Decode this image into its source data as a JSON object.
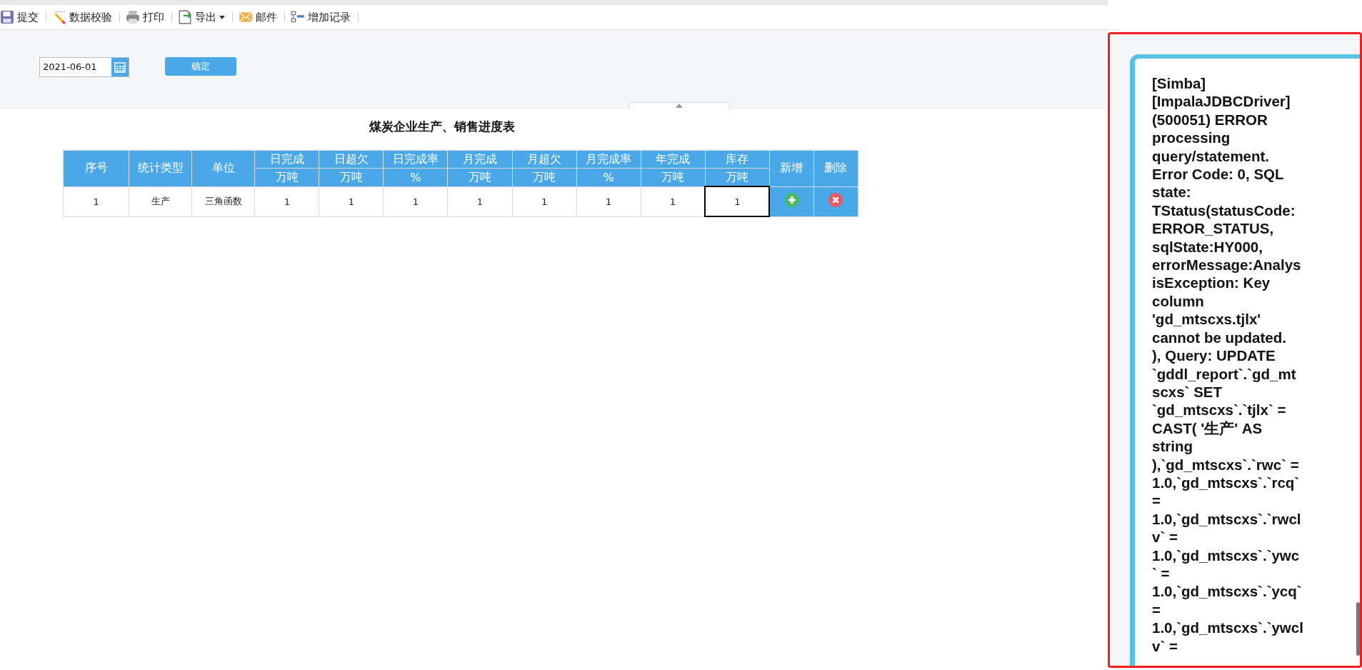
{
  "toolbar": [
    {
      "kind": "save",
      "label": "提交"
    },
    {
      "kind": "check",
      "label": "数据校验"
    },
    {
      "kind": "print",
      "label": "打印"
    },
    {
      "kind": "export",
      "label": "导出",
      "dropdown": true
    },
    {
      "kind": "mail",
      "label": "邮件"
    },
    {
      "kind": "add",
      "label": "增加记录"
    }
  ],
  "filter": {
    "date": "2021-06-01",
    "confirm": "确定"
  },
  "report": {
    "title": "煤炭企业生产、销售进度表",
    "columns": [
      {
        "label": "序号"
      },
      {
        "label": "统计类型"
      },
      {
        "label": "单位"
      },
      {
        "label": "日完成",
        "unit": "万吨"
      },
      {
        "label": "日超欠",
        "unit": "万吨"
      },
      {
        "label": "日完成率",
        "unit": "%"
      },
      {
        "label": "月完成",
        "unit": "万吨"
      },
      {
        "label": "月超欠",
        "unit": "万吨"
      },
      {
        "label": "月完成率",
        "unit": "%"
      },
      {
        "label": "年完成",
        "unit": "万吨"
      },
      {
        "label": "库存",
        "unit": "万吨"
      },
      {
        "label": "新增"
      },
      {
        "label": "删除"
      }
    ],
    "rows": [
      {
        "cells": [
          {
            "text": "1",
            "selected": false
          },
          {
            "text": "生产",
            "selected": false
          },
          {
            "text": "三角函数",
            "selected": false
          },
          {
            "text": "1",
            "selected": false
          },
          {
            "text": "1",
            "selected": false
          },
          {
            "text": "1",
            "selected": false
          },
          {
            "text": "1",
            "selected": false
          },
          {
            "text": "1",
            "selected": false
          },
          {
            "text": "1",
            "selected": false
          },
          {
            "text": "1",
            "selected": false
          },
          {
            "text": "1",
            "selected": true
          }
        ],
        "actions": [
          {
            "kind": "add"
          },
          {
            "kind": "delete"
          }
        ]
      }
    ]
  },
  "error_panel": {
    "lines": [
      "[Simba]",
      "[ImpalaJDBCDriver]",
      "(500051) ERROR",
      "processing",
      "query/statement.",
      "Error Code: 0, SQL",
      "state:",
      "TStatus(statusCode:",
      "ERROR_STATUS,",
      "sqlState:HY000,",
      "errorMessage:Analys",
      "isException: Key",
      "column",
      "'gd_mtscxs.tjlx'",
      "cannot be updated.",
      "), Query: UPDATE",
      "`gddl_report`.`gd_mt",
      "scxs` SET",
      "`gd_mtscxs`.`tjlx` =",
      "CAST( '生产' AS",
      "string",
      "),`gd_mtscxs`.`rwc` =",
      "1.0,`gd_mtscxs`.`rcq`",
      "=",
      "1.0,`gd_mtscxs`.`rwcl",
      "v` =",
      "1.0,`gd_mtscxs`.`ywc",
      "` =",
      "1.0,`gd_mtscxs`.`ycq`",
      "=",
      "1.0,`gd_mtscxs`.`ywcl",
      "v` ="
    ]
  }
}
